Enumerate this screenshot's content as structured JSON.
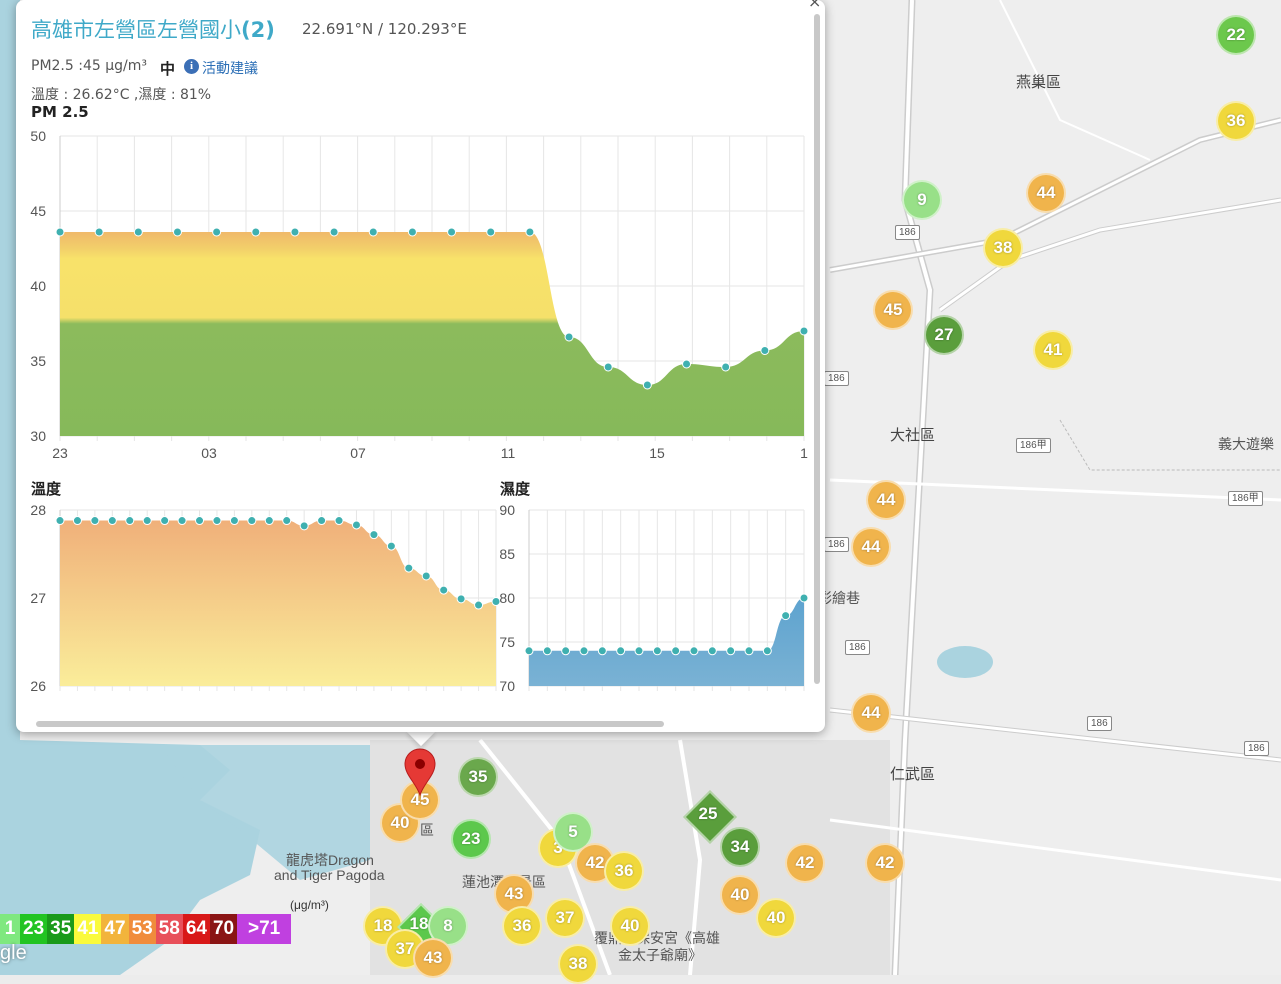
{
  "popup": {
    "title_name": "高雄市左營區左營國小",
    "title_suffix": "(2)",
    "coords": "22.691°N / 120.293°E",
    "pm_reading": "PM2.5 :45 μg/m³",
    "pm_level": "中",
    "advice_label": "活動建議",
    "temp_humidity": "溫度 : 26.62°C ,濕度 : 81%",
    "info_icon_glyph": "i",
    "close_glyph": "×"
  },
  "pm_chart": {
    "title": "PM 2.5",
    "y_ticks": [
      "50",
      "45",
      "40",
      "35",
      "30"
    ],
    "x_ticks": [
      "23",
      "03",
      "07",
      "11",
      "15",
      "1"
    ],
    "ylim": [
      30,
      50
    ]
  },
  "temp_chart": {
    "title": "溫度",
    "y_ticks": [
      "28",
      "27",
      "26"
    ],
    "ylim": [
      26,
      28
    ]
  },
  "humidity_chart": {
    "title": "濕度",
    "y_ticks": [
      "90",
      "85",
      "80",
      "75",
      "70"
    ],
    "ylim": [
      70,
      90
    ]
  },
  "chart_data": [
    {
      "type": "area",
      "title": "PM 2.5",
      "x": [
        0,
        1,
        2,
        3,
        4,
        5,
        6,
        7,
        8,
        9,
        10,
        11,
        12,
        13,
        14,
        15,
        16,
        17,
        18,
        19,
        20
      ],
      "values": [
        43.6,
        43.6,
        43.6,
        43.6,
        43.6,
        43.6,
        43.6,
        43.6,
        43.6,
        43.6,
        43.6,
        43.6,
        43.6,
        36.6,
        34.6,
        33.4,
        34.8,
        34.6,
        35.7,
        37.0
      ],
      "x_tick_labels": [
        "23",
        "03",
        "07",
        "11",
        "15",
        "1"
      ],
      "ylim": [
        30,
        50
      ]
    },
    {
      "type": "area",
      "title": "溫度",
      "values": [
        27.88,
        27.88,
        27.88,
        27.88,
        27.88,
        27.88,
        27.88,
        27.88,
        27.88,
        27.88,
        27.88,
        27.88,
        27.88,
        27.88,
        27.82,
        27.88,
        27.88,
        27.83,
        27.72,
        27.59,
        27.34,
        27.25,
        27.09,
        26.99,
        26.92,
        26.96
      ],
      "ylim": [
        26,
        28
      ]
    },
    {
      "type": "area",
      "title": "濕度",
      "values": [
        74,
        74,
        74,
        74,
        74,
        74,
        74,
        74,
        74,
        74,
        74,
        74,
        74,
        74,
        78,
        80
      ],
      "ylim": [
        70,
        90
      ]
    }
  ],
  "map": {
    "districts": {
      "yanchao": "燕巢區",
      "dashe": "大社區",
      "renwu": "仁武區",
      "lianchi": "蓮池潭風景區",
      "left_district": "區",
      "caihui": "彩繪巷",
      "dragon_tiger": "龍虎塔Dragon",
      "dragon_tiger2": "and Tiger Pagoda",
      "temple": "覆鼎金保安宮《高雄",
      "temple2": "金太子爺廟》",
      "yida": "義大遊樂"
    },
    "markers": [
      "22",
      "36",
      "9",
      "44",
      "38",
      "45",
      "27",
      "41",
      "44",
      "44",
      "44",
      "35",
      "45",
      "40",
      "23",
      "5",
      "3",
      "42",
      "36",
      "25",
      "34",
      "42",
      "42",
      "43",
      "36",
      "37",
      "40",
      "18",
      "8",
      "40",
      "37",
      "43",
      "38",
      "40",
      "36"
    ]
  },
  "legend": {
    "items": [
      "1",
      "23",
      "35",
      "41",
      "47",
      "53",
      "58",
      "64",
      "70",
      ">71"
    ],
    "colors": [
      "#7fe87f",
      "#22c422",
      "#1a9a1a",
      "#fafa3c",
      "#f2b43c",
      "#f08c3c",
      "#e8505a",
      "#d81818",
      "#8a1414",
      "#c040e0"
    ],
    "unit": "(μg/m³)"
  },
  "google": "gle"
}
